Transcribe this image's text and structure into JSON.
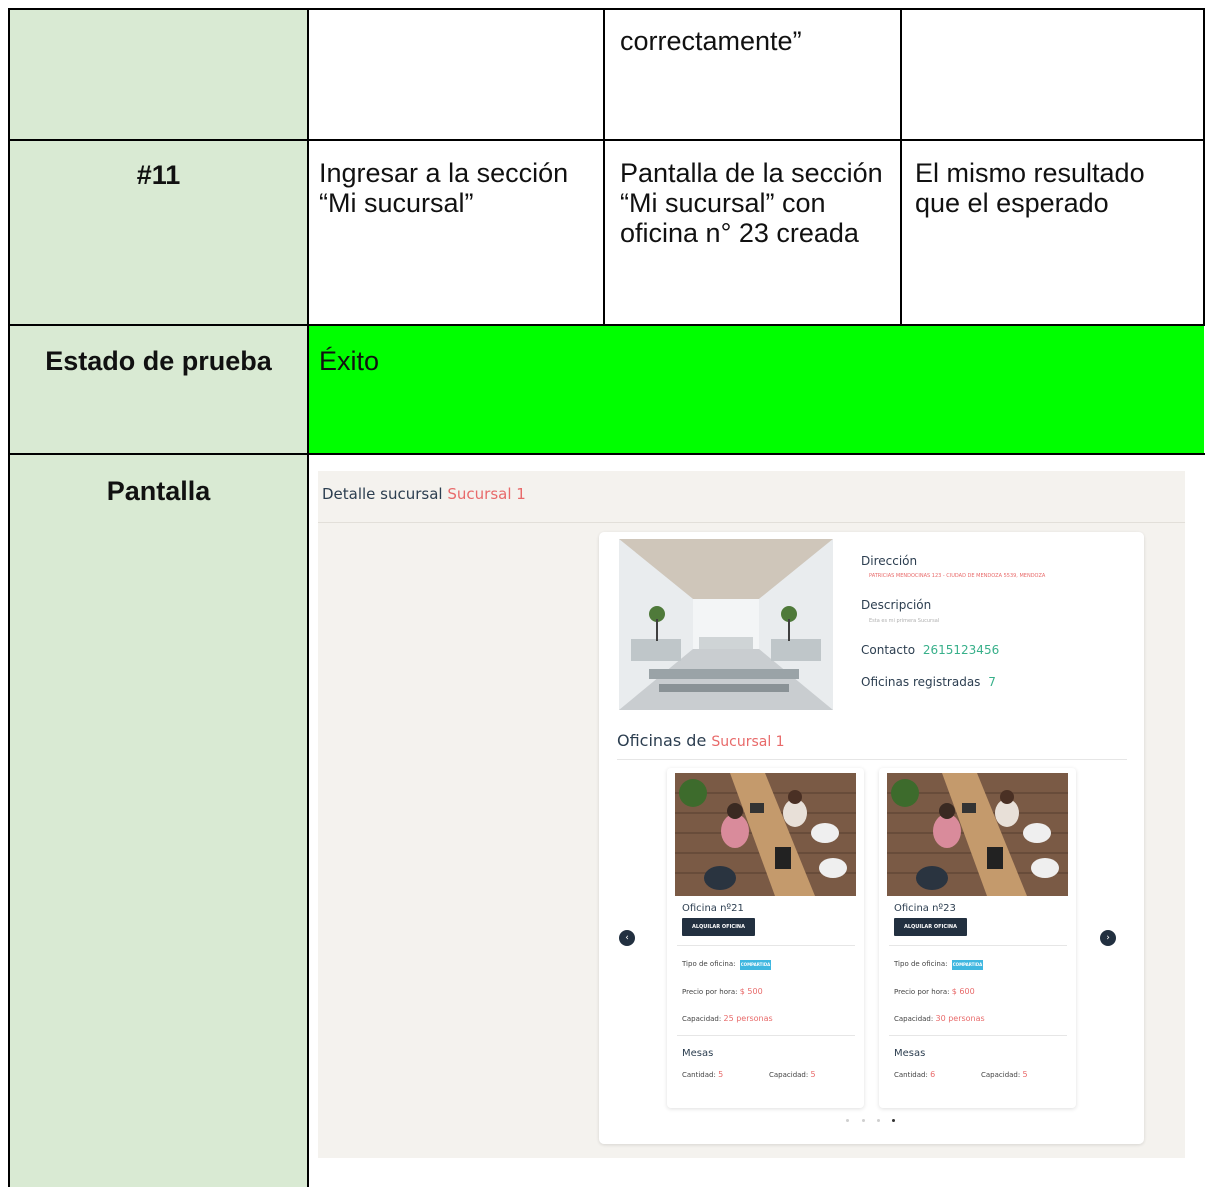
{
  "table": {
    "row1": {
      "result_continued": "correctamente”"
    },
    "row2": {
      "id": "#11",
      "step": "Ingresar a la sección “Mi sucursal”",
      "expected": "Pantalla de la sección “Mi sucursal” con oficina n° 23 creada",
      "actual": "El mismo resultado que el esperado"
    },
    "row3": {
      "label": "Estado de prueba",
      "value": "Éxito",
      "status_color": "#00ff00"
    },
    "row4": {
      "label": "Pantalla"
    },
    "label_column_color": "#d9ead3"
  },
  "screenshot": {
    "title_prefix": "Detalle sucursal",
    "title_highlight": "Sucursal 1",
    "info": {
      "address_label": "Dirección",
      "address_value": "PATRICIAS MENDOCINAS 123 - CIUDAD DE MENDOZA 5539, MENDOZA",
      "description_label": "Descripción",
      "description_value": "Esta es mi primera Sucursal",
      "contact_label": "Contacto",
      "contact_value": "2615123456",
      "offices_label": "Oficinas registradas",
      "offices_value": "7"
    },
    "offices_heading_prefix": "Oficinas de",
    "offices_heading_highlight": "Sucursal 1",
    "cards": [
      {
        "title": "Oficina nº21",
        "button": "ALQUILAR OFICINA",
        "type_label": "Tipo de oficina:",
        "type_value": "COMPARTIDA",
        "price_label": "Precio por hora:",
        "price_value": "$ 500",
        "capacity_label": "Capacidad:",
        "capacity_value": "25 personas",
        "tables_heading": "Mesas",
        "tables_qty_label": "Cantidad:",
        "tables_qty_value": "5",
        "tables_cap_label": "Capacidad:",
        "tables_cap_value": "5"
      },
      {
        "title": "Oficina nº23",
        "button": "ALQUILAR OFICINA",
        "type_label": "Tipo de oficina:",
        "type_value": "COMPARTIDA",
        "price_label": "Precio por hora:",
        "price_value": "$ 600",
        "capacity_label": "Capacidad:",
        "capacity_value": "30 personas",
        "tables_heading": "Mesas",
        "tables_qty_label": "Cantidad:",
        "tables_qty_value": "6",
        "tables_cap_label": "Capacidad:",
        "tables_cap_value": "5"
      }
    ],
    "carousel": {
      "pages": 4,
      "active_page": 4
    },
    "accent_color": "#e86a6a",
    "contact_color": "#38b08a"
  }
}
